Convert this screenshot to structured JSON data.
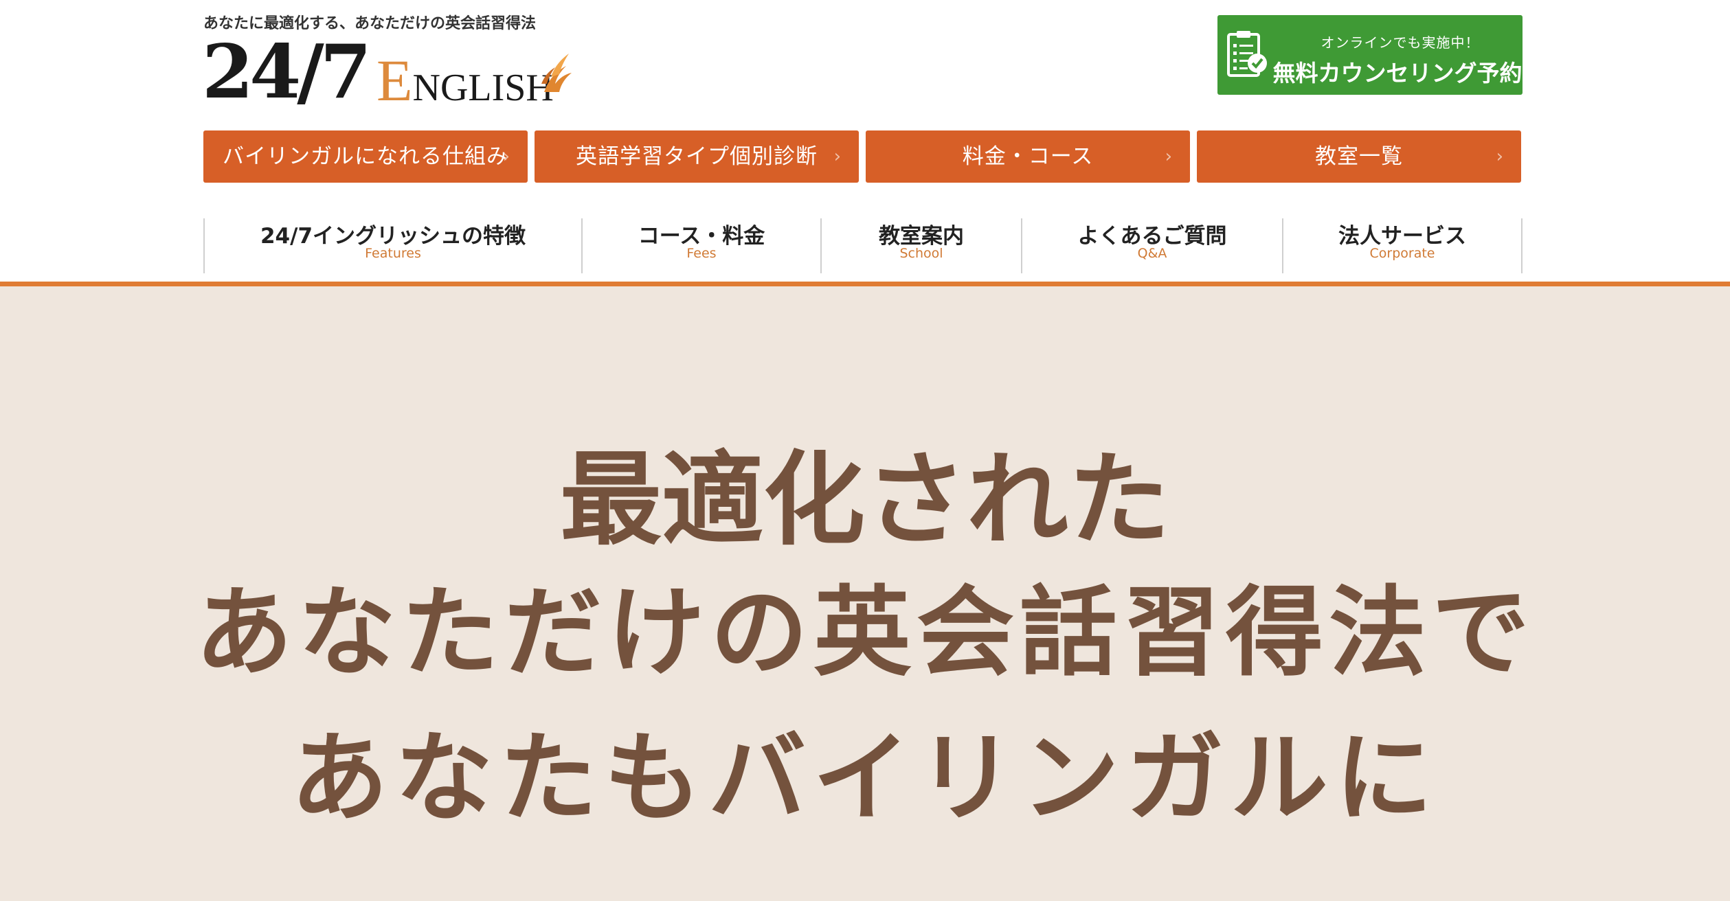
{
  "header": {
    "tagline": "あなたに最適化する、あなただけの英会話習得法",
    "logo": {
      "numerals": "24/7",
      "word_initial": "E",
      "word_rest": "NGLISH",
      "mark_icon": "flame-wing-icon"
    },
    "cta": {
      "sub_label": "オンラインでも実施中！",
      "main_label": "無料カウンセリング予約",
      "icon": "clipboard-check-icon",
      "color": "#3f9a35"
    }
  },
  "nav_buttons": [
    {
      "label": "バイリンガルになれる仕組み"
    },
    {
      "label": "英語学習タイプ個別診断"
    },
    {
      "label": "料金・コース"
    },
    {
      "label": "教室一覧"
    }
  ],
  "menu": [
    {
      "label": "24/7イングリッシュの特徴",
      "sub": "Features"
    },
    {
      "label": "コース・料金",
      "sub": "Fees"
    },
    {
      "label": "教室案内",
      "sub": "School"
    },
    {
      "label": "よくあるご質問",
      "sub": "Q&A"
    },
    {
      "label": "法人サービス",
      "sub": "Corporate"
    }
  ],
  "hero": {
    "line1": "最適化された",
    "line2": "あなただけの英会話習得法で",
    "line3": "あなたもバイリンガルに"
  },
  "colors": {
    "accent_orange": "#d75f27",
    "rule_orange": "#e07c34",
    "hero_bg": "#efe6dd",
    "hero_text": "#74523d"
  }
}
